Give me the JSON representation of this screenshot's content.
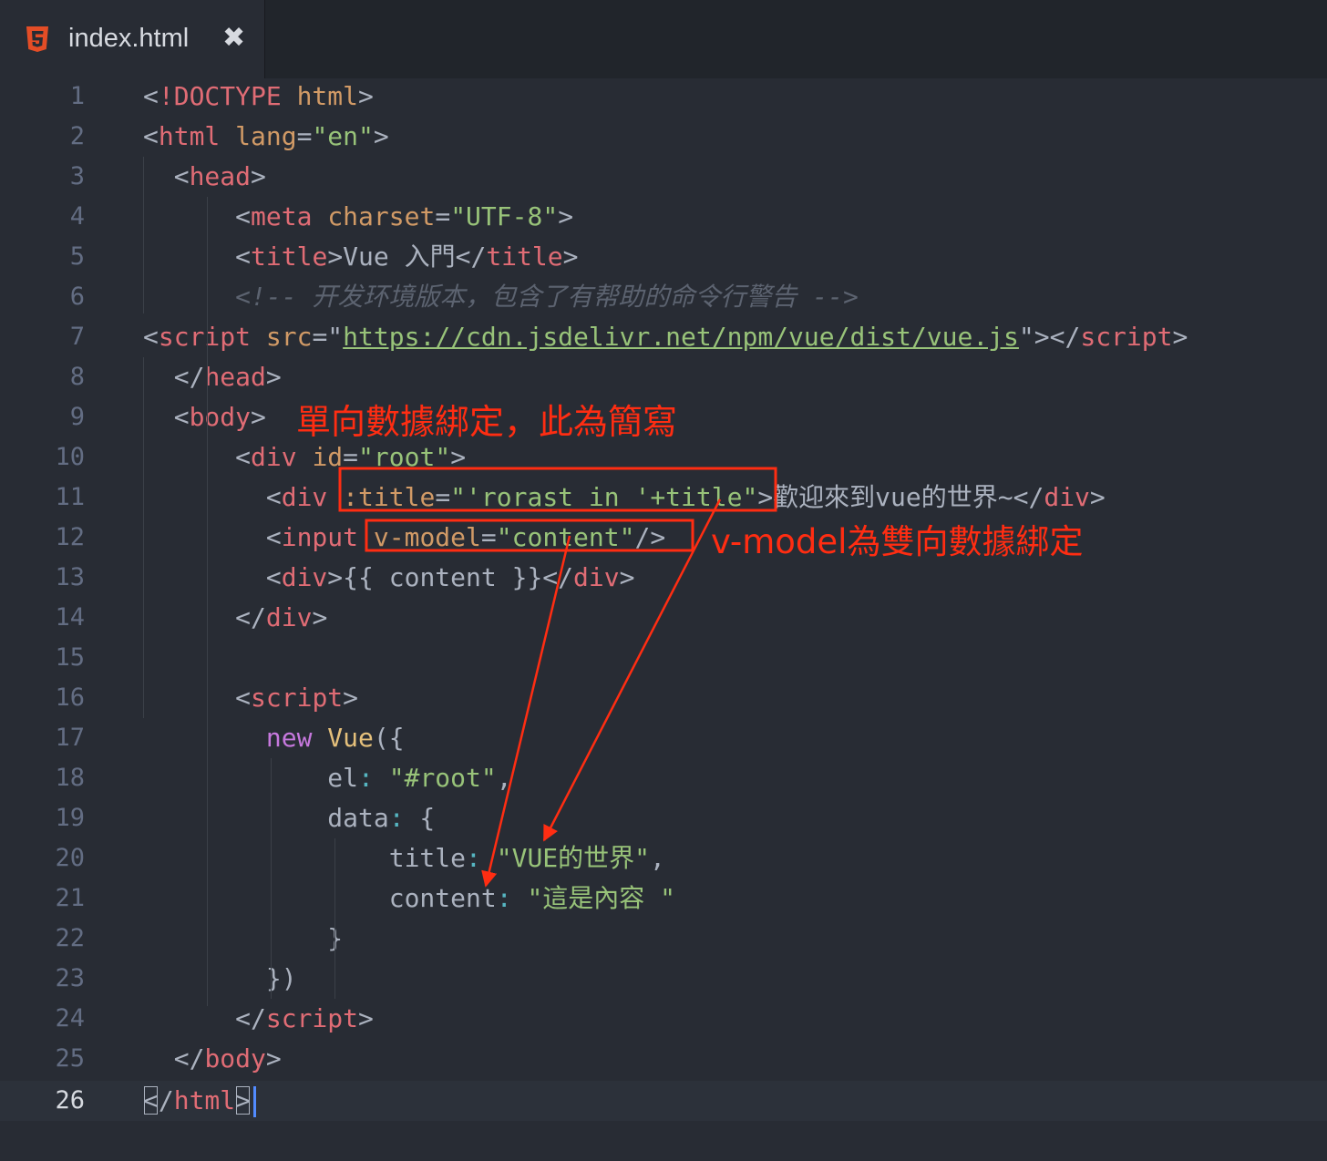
{
  "tab": {
    "filename": "index.html",
    "icon": "html5-icon",
    "close_glyph": "✖",
    "icon_color": "#e44d26"
  },
  "editor": {
    "current_line": 26,
    "lines": [
      {
        "n": "1",
        "tokens": [
          [
            "punc",
            "<"
          ],
          [
            "tag",
            "!DOCTYPE"
          ],
          [
            "punc",
            " "
          ],
          [
            "attr",
            "html"
          ],
          [
            "punc",
            ">"
          ]
        ]
      },
      {
        "n": "2",
        "tokens": [
          [
            "punc",
            "<"
          ],
          [
            "tag",
            "html"
          ],
          [
            "punc",
            " "
          ],
          [
            "attr",
            "lang"
          ],
          [
            "punc",
            "="
          ],
          [
            "str",
            "\"en\""
          ],
          [
            "punc",
            ">"
          ]
        ]
      },
      {
        "n": "3",
        "tokens": [
          [
            "punc",
            "  <"
          ],
          [
            "tag",
            "head"
          ],
          [
            "punc",
            ">"
          ]
        ]
      },
      {
        "n": "4",
        "tokens": [
          [
            "punc",
            "      <"
          ],
          [
            "tag",
            "meta"
          ],
          [
            "punc",
            " "
          ],
          [
            "attr",
            "charset"
          ],
          [
            "punc",
            "="
          ],
          [
            "str",
            "\"UTF-8\""
          ],
          [
            "punc",
            ">"
          ]
        ]
      },
      {
        "n": "5",
        "tokens": [
          [
            "punc",
            "      <"
          ],
          [
            "tag",
            "title"
          ],
          [
            "punc",
            ">Vue 入門</"
          ],
          [
            "tag",
            "title"
          ],
          [
            "punc",
            ">"
          ]
        ]
      },
      {
        "n": "6",
        "tokens": [
          [
            "com",
            "      <!-- 开发环境版本，包含了有帮助的命令行警告 -->"
          ]
        ]
      },
      {
        "n": "7",
        "tokens": [
          [
            "punc",
            "<"
          ],
          [
            "tag",
            "script"
          ],
          [
            "punc",
            " "
          ],
          [
            "attr",
            "src"
          ],
          [
            "punc",
            "=\""
          ],
          [
            "link",
            "https://cdn.jsdelivr.net/npm/vue/dist/vue.js"
          ],
          [
            "punc",
            "\"></"
          ],
          [
            "tag",
            "script"
          ],
          [
            "punc",
            ">"
          ]
        ]
      },
      {
        "n": "8",
        "tokens": [
          [
            "punc",
            "  </"
          ],
          [
            "tag",
            "head"
          ],
          [
            "punc",
            ">"
          ]
        ]
      },
      {
        "n": "9",
        "tokens": [
          [
            "punc",
            "  <"
          ],
          [
            "tag",
            "body"
          ],
          [
            "punc",
            ">"
          ]
        ]
      },
      {
        "n": "10",
        "tokens": [
          [
            "punc",
            "      <"
          ],
          [
            "tag",
            "div"
          ],
          [
            "punc",
            " "
          ],
          [
            "attr",
            "id"
          ],
          [
            "punc",
            "="
          ],
          [
            "str",
            "\"root\""
          ],
          [
            "punc",
            ">"
          ]
        ]
      },
      {
        "n": "11",
        "tokens": [
          [
            "punc",
            "        <"
          ],
          [
            "tag",
            "div"
          ],
          [
            "punc",
            " "
          ],
          [
            "attr",
            ":title"
          ],
          [
            "punc",
            "="
          ],
          [
            "str",
            "\"'rorast in '+title\""
          ],
          [
            "punc",
            ">歡迎來到vue的世界~</"
          ],
          [
            "tag",
            "div"
          ],
          [
            "punc",
            ">"
          ]
        ]
      },
      {
        "n": "12",
        "tokens": [
          [
            "punc",
            "        <"
          ],
          [
            "tag",
            "input"
          ],
          [
            "punc",
            " "
          ],
          [
            "attr",
            "v-model"
          ],
          [
            "punc",
            "="
          ],
          [
            "str",
            "\"content\""
          ],
          [
            "punc",
            "/>"
          ]
        ]
      },
      {
        "n": "13",
        "tokens": [
          [
            "punc",
            "        <"
          ],
          [
            "tag",
            "div"
          ],
          [
            "punc",
            ">{{ content }}</"
          ],
          [
            "tag",
            "div"
          ],
          [
            "punc",
            ">"
          ]
        ]
      },
      {
        "n": "14",
        "tokens": [
          [
            "punc",
            "      </"
          ],
          [
            "tag",
            "div"
          ],
          [
            "punc",
            ">"
          ]
        ]
      },
      {
        "n": "15",
        "tokens": []
      },
      {
        "n": "16",
        "tokens": [
          [
            "punc",
            "      <"
          ],
          [
            "tag",
            "script"
          ],
          [
            "punc",
            ">"
          ]
        ]
      },
      {
        "n": "17",
        "tokens": [
          [
            "punc",
            "        "
          ],
          [
            "kw",
            "new"
          ],
          [
            "punc",
            " "
          ],
          [
            "cls",
            "Vue"
          ],
          [
            "punc",
            "({"
          ]
        ]
      },
      {
        "n": "18",
        "tokens": [
          [
            "punc",
            "            el"
          ],
          [
            "op",
            ":"
          ],
          [
            "punc",
            " "
          ],
          [
            "str",
            "\"#root\""
          ],
          [
            "punc",
            ","
          ]
        ]
      },
      {
        "n": "19",
        "tokens": [
          [
            "punc",
            "            data"
          ],
          [
            "op",
            ":"
          ],
          [
            "punc",
            " {"
          ]
        ]
      },
      {
        "n": "20",
        "tokens": [
          [
            "punc",
            "                title"
          ],
          [
            "op",
            ":"
          ],
          [
            "punc",
            " "
          ],
          [
            "str",
            "\"VUE的世界\""
          ],
          [
            "punc",
            ","
          ]
        ]
      },
      {
        "n": "21",
        "tokens": [
          [
            "punc",
            "                content"
          ],
          [
            "op",
            ":"
          ],
          [
            "punc",
            " "
          ],
          [
            "str",
            "\"這是內容 \""
          ]
        ]
      },
      {
        "n": "22",
        "tokens": [
          [
            "punc",
            "            }"
          ]
        ]
      },
      {
        "n": "23",
        "tokens": [
          [
            "punc",
            "        })"
          ]
        ]
      },
      {
        "n": "24",
        "tokens": [
          [
            "punc",
            "      </"
          ],
          [
            "tag",
            "script"
          ],
          [
            "punc",
            ">"
          ]
        ]
      },
      {
        "n": "25",
        "tokens": [
          [
            "punc",
            "  </"
          ],
          [
            "tag",
            "body"
          ],
          [
            "punc",
            ">"
          ]
        ]
      },
      {
        "n": "26",
        "tokens": [
          [
            "bracket",
            "<"
          ],
          [
            "punc",
            "/"
          ],
          [
            "tag",
            "html"
          ],
          [
            "bracket",
            ">"
          ]
        ]
      }
    ]
  },
  "annotations": {
    "one_way_binding": "單向數據綁定，此為簡寫",
    "two_way_binding": "v-model為雙向數據綁定",
    "color": "#ff2d12"
  }
}
